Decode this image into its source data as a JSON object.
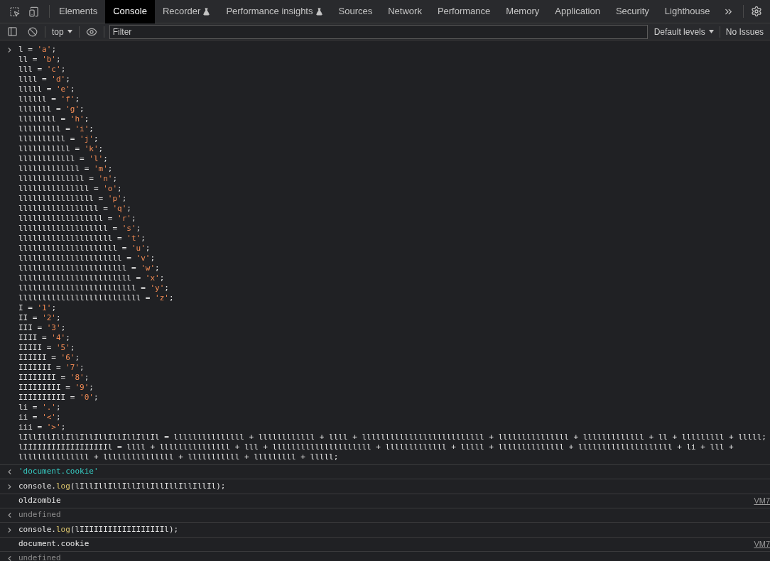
{
  "tabs": [
    {
      "label": "Elements",
      "selected": false,
      "experimental": false
    },
    {
      "label": "Console",
      "selected": true,
      "experimental": false
    },
    {
      "label": "Recorder",
      "selected": false,
      "experimental": true
    },
    {
      "label": "Performance insights",
      "selected": false,
      "experimental": true
    },
    {
      "label": "Sources",
      "selected": false,
      "experimental": false
    },
    {
      "label": "Network",
      "selected": false,
      "experimental": false
    },
    {
      "label": "Performance",
      "selected": false,
      "experimental": false
    },
    {
      "label": "Memory",
      "selected": false,
      "experimental": false
    },
    {
      "label": "Application",
      "selected": false,
      "experimental": false
    },
    {
      "label": "Security",
      "selected": false,
      "experimental": false
    },
    {
      "label": "Lighthouse",
      "selected": false,
      "experimental": false
    }
  ],
  "console_toolbar": {
    "context": "top",
    "filter": {
      "placeholder": "Filter"
    },
    "levels": "Default levels",
    "issues": "No Issues"
  },
  "messages": [
    {
      "kind": "input",
      "lines": [
        "l = 'a';",
        "ll = 'b';",
        "lll = 'c';",
        "llll = 'd';",
        "lllll = 'e';",
        "llllll = 'f';",
        "lllllll = 'g';",
        "llllllll = 'h';",
        "lllllllll = 'i';",
        "llllllllll = 'j';",
        "lllllllllll = 'k';",
        "llllllllllll = 'l';",
        "lllllllllllll = 'm';",
        "llllllllllllll = 'n';",
        "lllllllllllllll = 'o';",
        "llllllllllllllll = 'p';",
        "lllllllllllllllll = 'q';",
        "llllllllllllllllll = 'r';",
        "lllllllllllllllllll = 's';",
        "llllllllllllllllllll = 't';",
        "lllllllllllllllllllll = 'u';",
        "llllllllllllllllllllll = 'v';",
        "lllllllllllllllllllllll = 'w';",
        "llllllllllllllllllllllll = 'x';",
        "lllllllllllllllllllllllll = 'y';",
        "llllllllllllllllllllllllll = 'z';",
        "I = '1';",
        "II = '2';",
        "III = '3';",
        "IIII = '4';",
        "IIIII = '5';",
        "IIIIII = '6';",
        "IIIIIII = '7';",
        "IIIIIIII = '8';",
        "IIIIIIIII = '9';",
        "IIIIIIIIII = '0';",
        "li = '.';",
        "ii = '<';",
        "iii = '>';",
        "lIllIllIllIllIllIllIllIllIllIl = lllllllllllllll + llllllllllll + llll + llllllllllllllllllllllllll + lllllllllllllll + lllllllllllll + ll + lllllllll + lllll;",
        "lIIIIIIIIIIIIIIIIIIl = llll + lllllllllllllll + lll + lllllllllllllllllllll + lllllllllllll + lllll + llllllllllllll + llllllllllllllllllll + li + lll +",
        "lllllllllllllll + lllllllllllllll + lllllllllll + lllllllll + lllll;"
      ]
    },
    {
      "kind": "string",
      "text": "'document.cookie'"
    },
    {
      "kind": "input",
      "lines": [
        "console.log(lIllIllIllIllIllIllIllIllIllIl);"
      ]
    },
    {
      "kind": "log",
      "text": "oldzombie",
      "source": "VM7"
    },
    {
      "kind": "void",
      "text": "undefined"
    },
    {
      "kind": "input",
      "lines": [
        "console.log(lIIIIIIIIIIIIIIIIIIl);"
      ]
    },
    {
      "kind": "log",
      "text": "document.cookie",
      "source": "VM7"
    },
    {
      "kind": "void",
      "text": "undefined"
    }
  ]
}
